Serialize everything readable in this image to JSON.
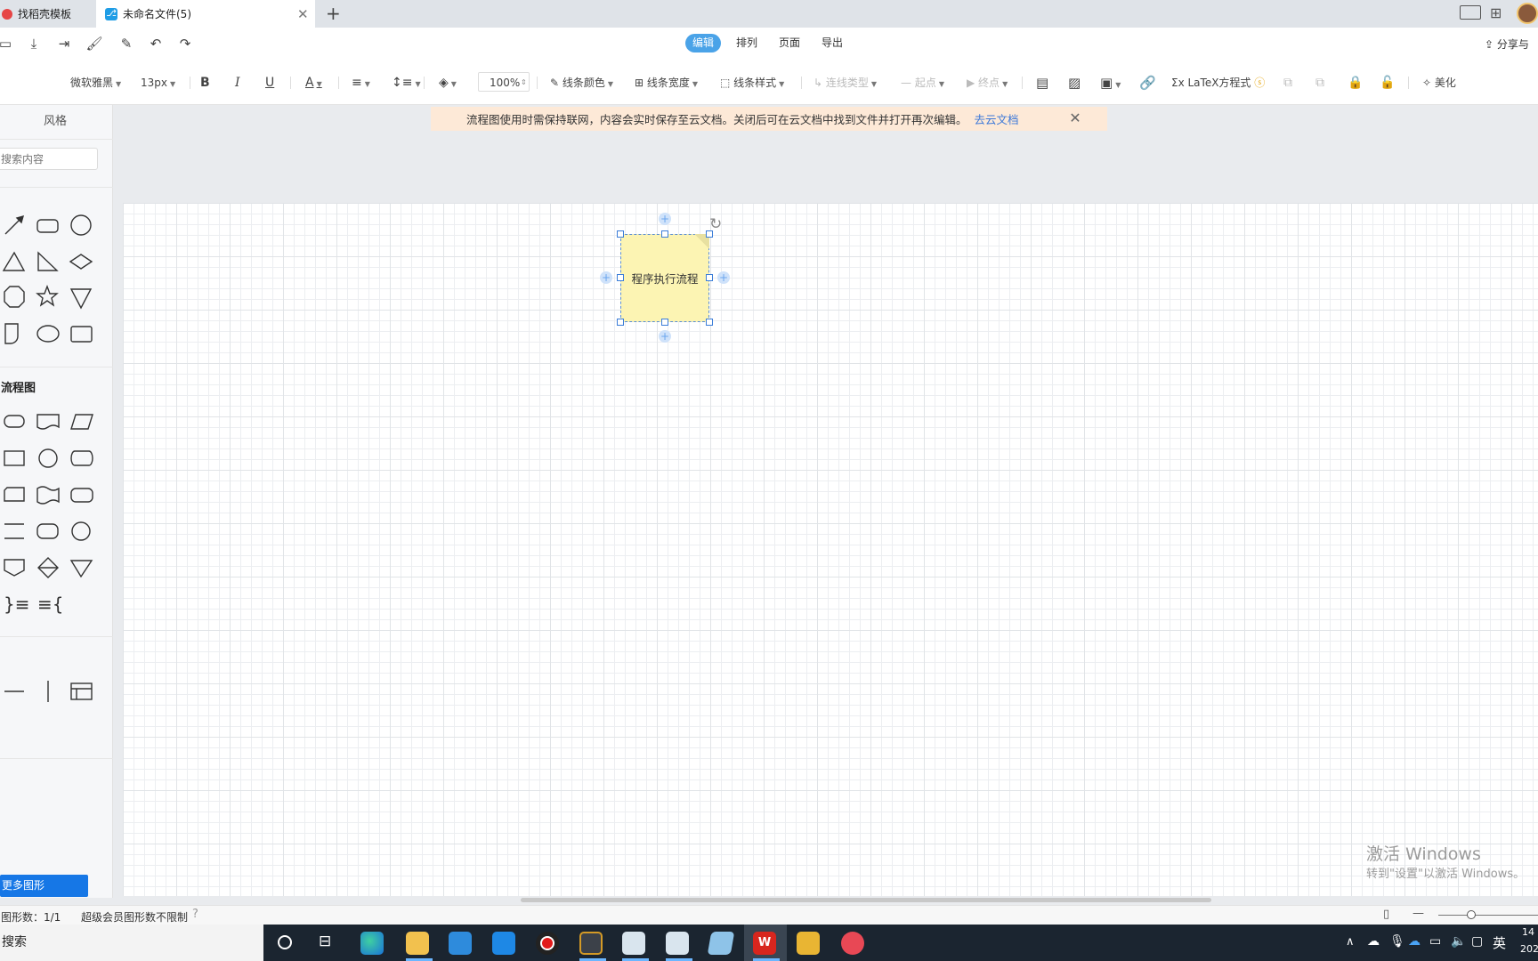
{
  "tabs": [
    {
      "label": "找稻壳模板"
    },
    {
      "label": "未命名文件(5)"
    }
  ],
  "new_tab": "+",
  "menu": {
    "tabs": [
      "编辑",
      "排列",
      "页面",
      "导出"
    ],
    "share": "分享与"
  },
  "toolbar": {
    "font": "微软雅黑",
    "size": "13px",
    "bold": "B",
    "italic": "I",
    "underline": "U",
    "fontcolor": "A",
    "zoom": "100%",
    "line_color": "线条颜色",
    "line_width": "线条宽度",
    "line_style": "线条样式",
    "conn_type": "连线类型",
    "start": "起点",
    "end": "终点",
    "latex": "LaTeX方程式",
    "beautify": "美化"
  },
  "sidebar": {
    "style": "风格",
    "search_placeholder": "搜索内容",
    "flow_title": "流程图",
    "more": "更多图形"
  },
  "notice": {
    "text": "流程图使用时需保持联网，内容会实时保存至云文档。关闭后可在云文档中找到文件并打开再次编辑。",
    "link": "去云文档"
  },
  "node": {
    "label": "程序执行流程"
  },
  "status": {
    "count": "图形数：1/1",
    "vip": "超级会员图形数不限制"
  },
  "watermark": {
    "line1": "激活 Windows",
    "line2": "转到\"设置\"以激活 Windows。"
  },
  "taskbar": {
    "search": "搜索",
    "lang": "英",
    "time": "14",
    "date": "202"
  }
}
